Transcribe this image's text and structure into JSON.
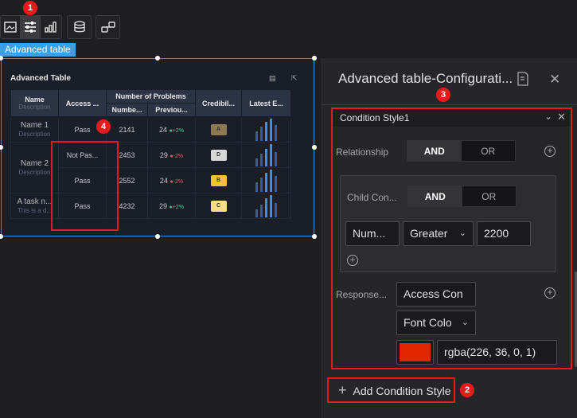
{
  "toolbar": {
    "icons": [
      "image-icon",
      "sliders-icon",
      "bar-chart-icon",
      "database-icon",
      "link-icon"
    ]
  },
  "markers": {
    "m1": "1",
    "m2": "2",
    "m3": "3",
    "m4": "4"
  },
  "selection_tag": "Advanced table",
  "widget": {
    "title": "Advanced Table",
    "headers": {
      "name": "Name",
      "description": "Description",
      "access": "Access ...",
      "num_group": "Number of Problems",
      "number": "Numbe...",
      "previous": "Previou...",
      "credibility": "Credibil...",
      "latest": "Latest E..."
    },
    "rows": [
      {
        "name": "Name 1",
        "desc": "Description",
        "access": "Pass",
        "number": "2141",
        "prev": "24",
        "trend": "+2%"
      },
      {
        "name": "",
        "desc": "",
        "access": "Not Pas...",
        "number": "2453",
        "prev": "29",
        "trend": "-2%"
      },
      {
        "name": "Name 2",
        "desc": "Description",
        "access": "Pass",
        "number": "2552",
        "prev": "24",
        "trend": "-2%"
      },
      {
        "name": "A task n...",
        "desc": "This is a d...",
        "access": "Pass",
        "number": "4232",
        "prev": "29",
        "trend": "+2%"
      }
    ],
    "badges": [
      "A",
      "D",
      "B",
      "C"
    ]
  },
  "panel": {
    "title": "Advanced table-Configurati...",
    "condition_name": "Condition Style1",
    "relationship_label": "Relationship",
    "and_label": "AND",
    "or_label": "OR",
    "child_label": "Child Con...",
    "field_value": "Num...",
    "operator_value": "Greater",
    "threshold_value": "2200",
    "response_label": "Response...",
    "response_field": "Access Con",
    "style_prop": "Font Colo",
    "color_value": "rgba(226, 36, 0, 1)",
    "color_hex": "#e22400",
    "add_label": "Add Condition Style"
  }
}
